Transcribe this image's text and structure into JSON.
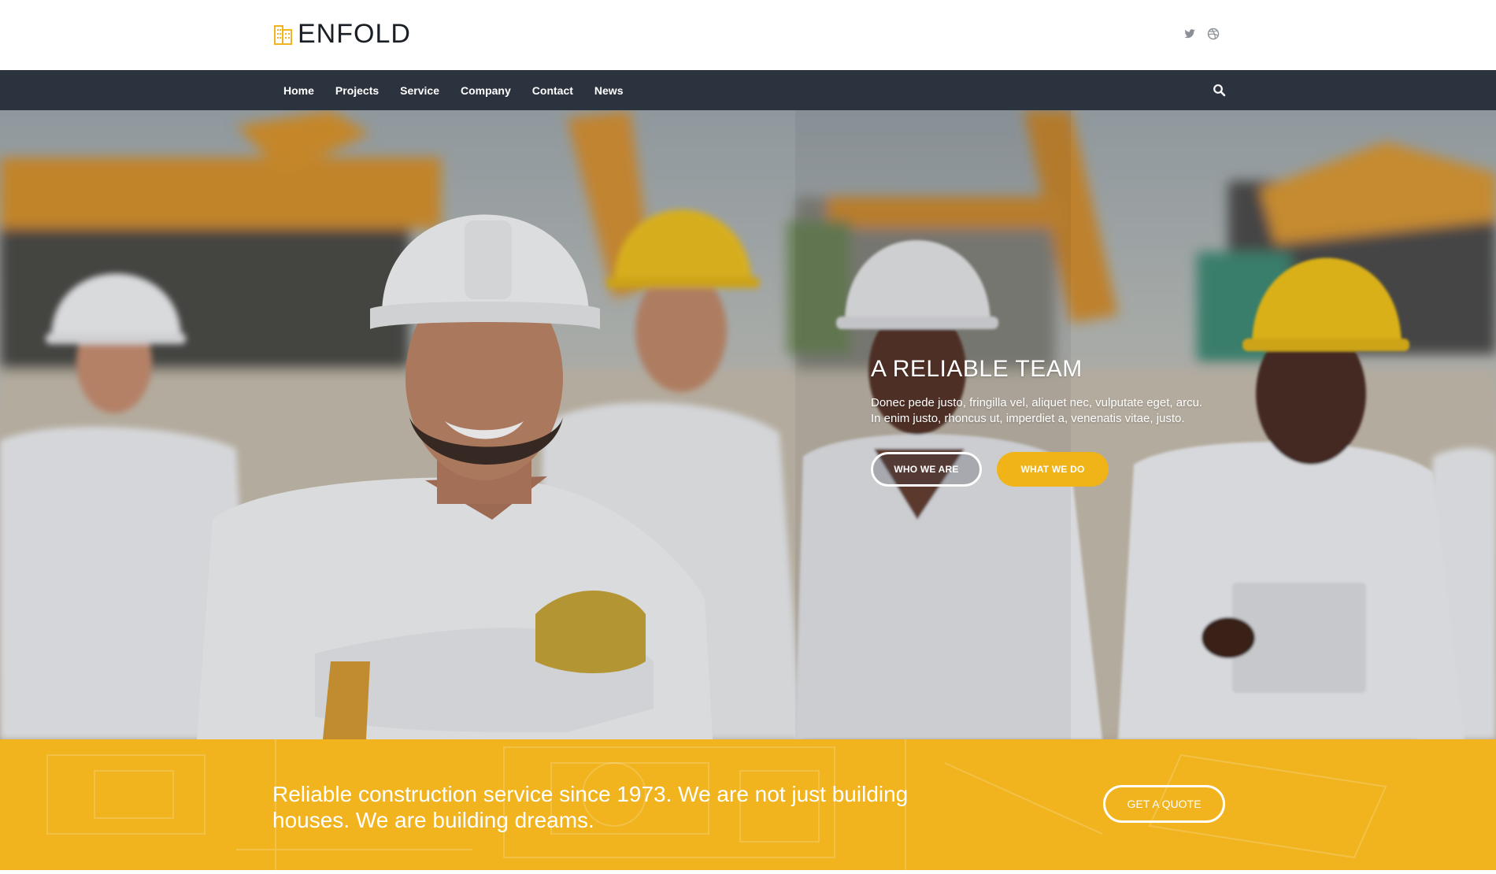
{
  "brand": {
    "name": "ENFOLD",
    "logo_icon": "building-icon",
    "accent_color": "#f1b41f",
    "nav_color": "#2b333e"
  },
  "header": {
    "social": [
      "twitter-icon",
      "dribbble-icon"
    ]
  },
  "nav": {
    "items": [
      "Home",
      "Projects",
      "Service",
      "Company",
      "Contact",
      "News"
    ],
    "search_icon": "search-icon"
  },
  "hero": {
    "title": "A RELIABLE TEAM",
    "text": "Donec pede justo, fringilla vel, aliquet nec, vulputate eget, arcu. In enim justo, rhoncus ut, imperdiet a, venenatis vitae, justo.",
    "buttons": {
      "primary": "WHO WE ARE",
      "secondary": "WHAT WE DO"
    }
  },
  "band": {
    "text": "Reliable construction service since 1973. We are not just building houses. We are building dreams.",
    "button": "GET A QUOTE"
  }
}
